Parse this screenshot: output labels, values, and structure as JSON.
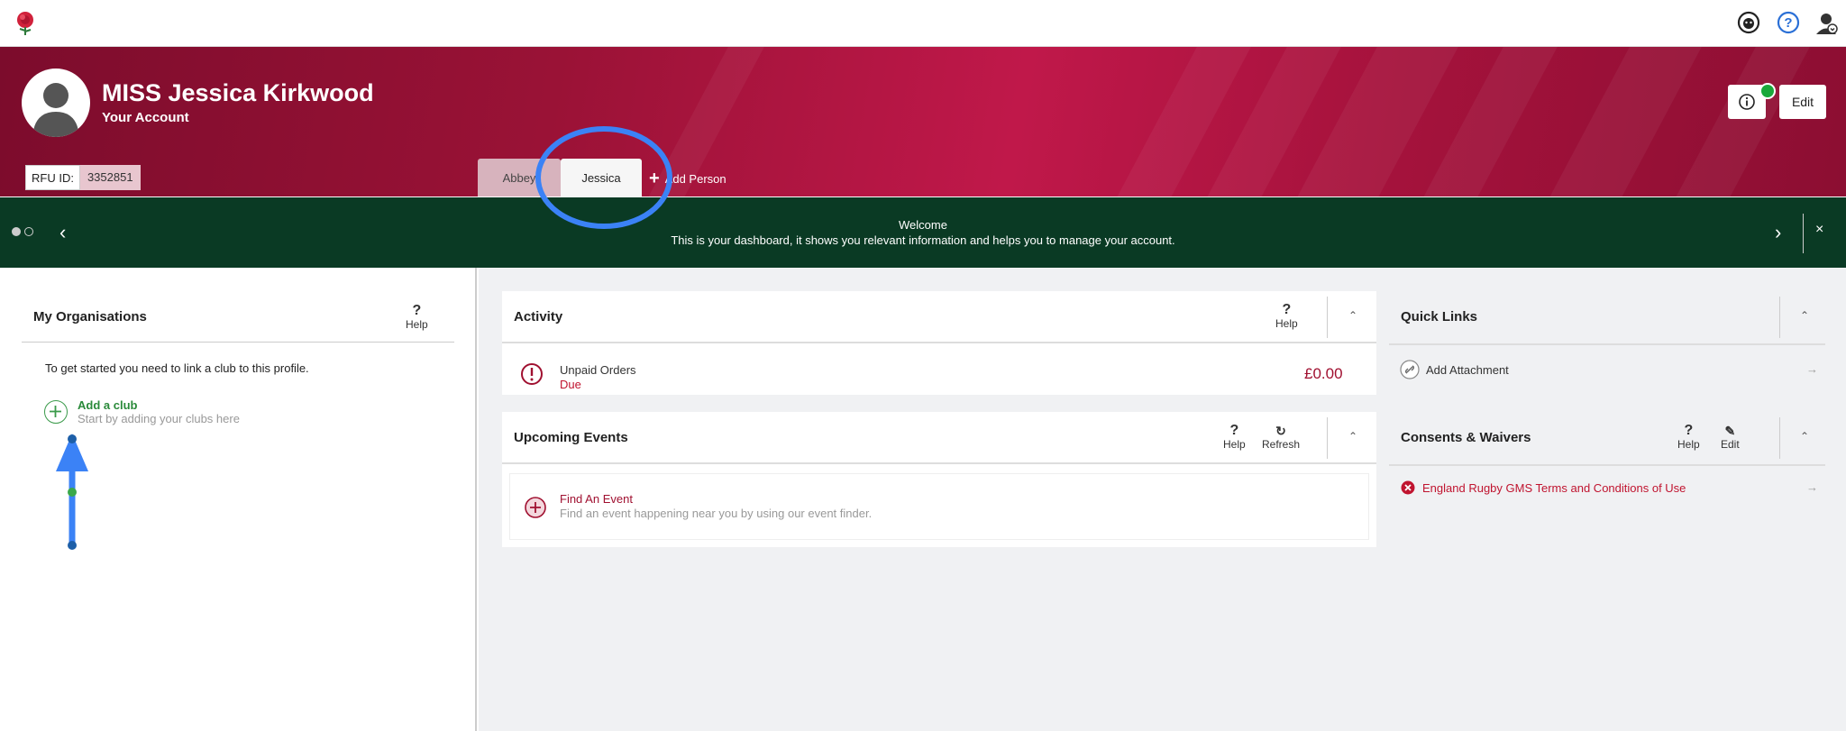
{
  "header": {
    "name": "MISS Jessica Kirkwood",
    "subtitle": "Your Account",
    "rfu_label": "RFU ID:",
    "rfu_value": "3352851",
    "tabs": [
      {
        "label": "Abbey"
      },
      {
        "label": "Jessica"
      }
    ],
    "add_person": "Add Person",
    "edit_label": "Edit"
  },
  "banner": {
    "title": "Welcome",
    "text": "This is your dashboard, it shows you relevant information and helps you to manage your account.",
    "close": "×"
  },
  "organisations": {
    "title": "My Organisations",
    "help": "Help",
    "message": "To get started you need to link a club to this profile.",
    "add_club_title": "Add a club",
    "add_club_sub": "Start by adding your clubs here"
  },
  "activity": {
    "title": "Activity",
    "help": "Help",
    "row_title": "Unpaid Orders",
    "row_status": "Due",
    "amount": "£0.00"
  },
  "events": {
    "title": "Upcoming Events",
    "help": "Help",
    "refresh": "Refresh",
    "find_title": "Find An Event",
    "find_sub": "Find an event happening near you by using our event finder."
  },
  "quick_links": {
    "title": "Quick Links",
    "attachment": "Add Attachment"
  },
  "consents": {
    "title": "Consents & Waivers",
    "help": "Help",
    "edit": "Edit",
    "item": "England Rugby GMS Terms and Conditions of Use"
  },
  "colors": {
    "brand": "#a5123c",
    "banner": "#0a3a24",
    "annotation": "#3b82f6"
  }
}
